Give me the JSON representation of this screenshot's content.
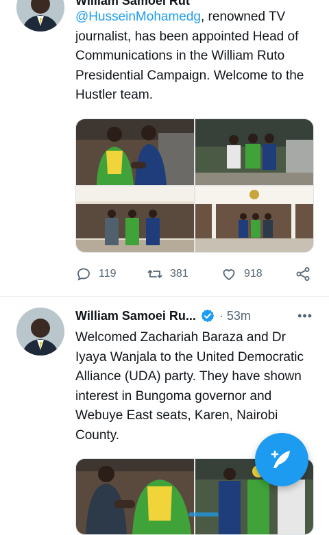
{
  "tweet1": {
    "name": "William Samoei Rut",
    "text_mention": "@HusseinMohamedg",
    "text_rest": ", renowned TV journalist, has been appointed Head of Communications in the William Ruto Presidential Campaign. Welcome to the Hustler team.",
    "reply_count": "119",
    "retweet_count": "381",
    "like_count": "918"
  },
  "tweet2": {
    "name": "William Samoei Ru...",
    "time": "· 53m",
    "more": "•••",
    "text": "Welcomed Zachariah Baraza and Dr Iyaya Wanjala to the United Democratic Alliance (UDA) party. They have shown interest in Bungoma governor and Webuye East seats, Karen, Nairobi County."
  },
  "colors": {
    "accent": "#1d9bf0",
    "text": "#0f1419",
    "muted": "#536471"
  },
  "icons": [
    "reply-icon",
    "retweet-icon",
    "like-icon",
    "share-icon",
    "verified-icon",
    "compose-icon"
  ]
}
